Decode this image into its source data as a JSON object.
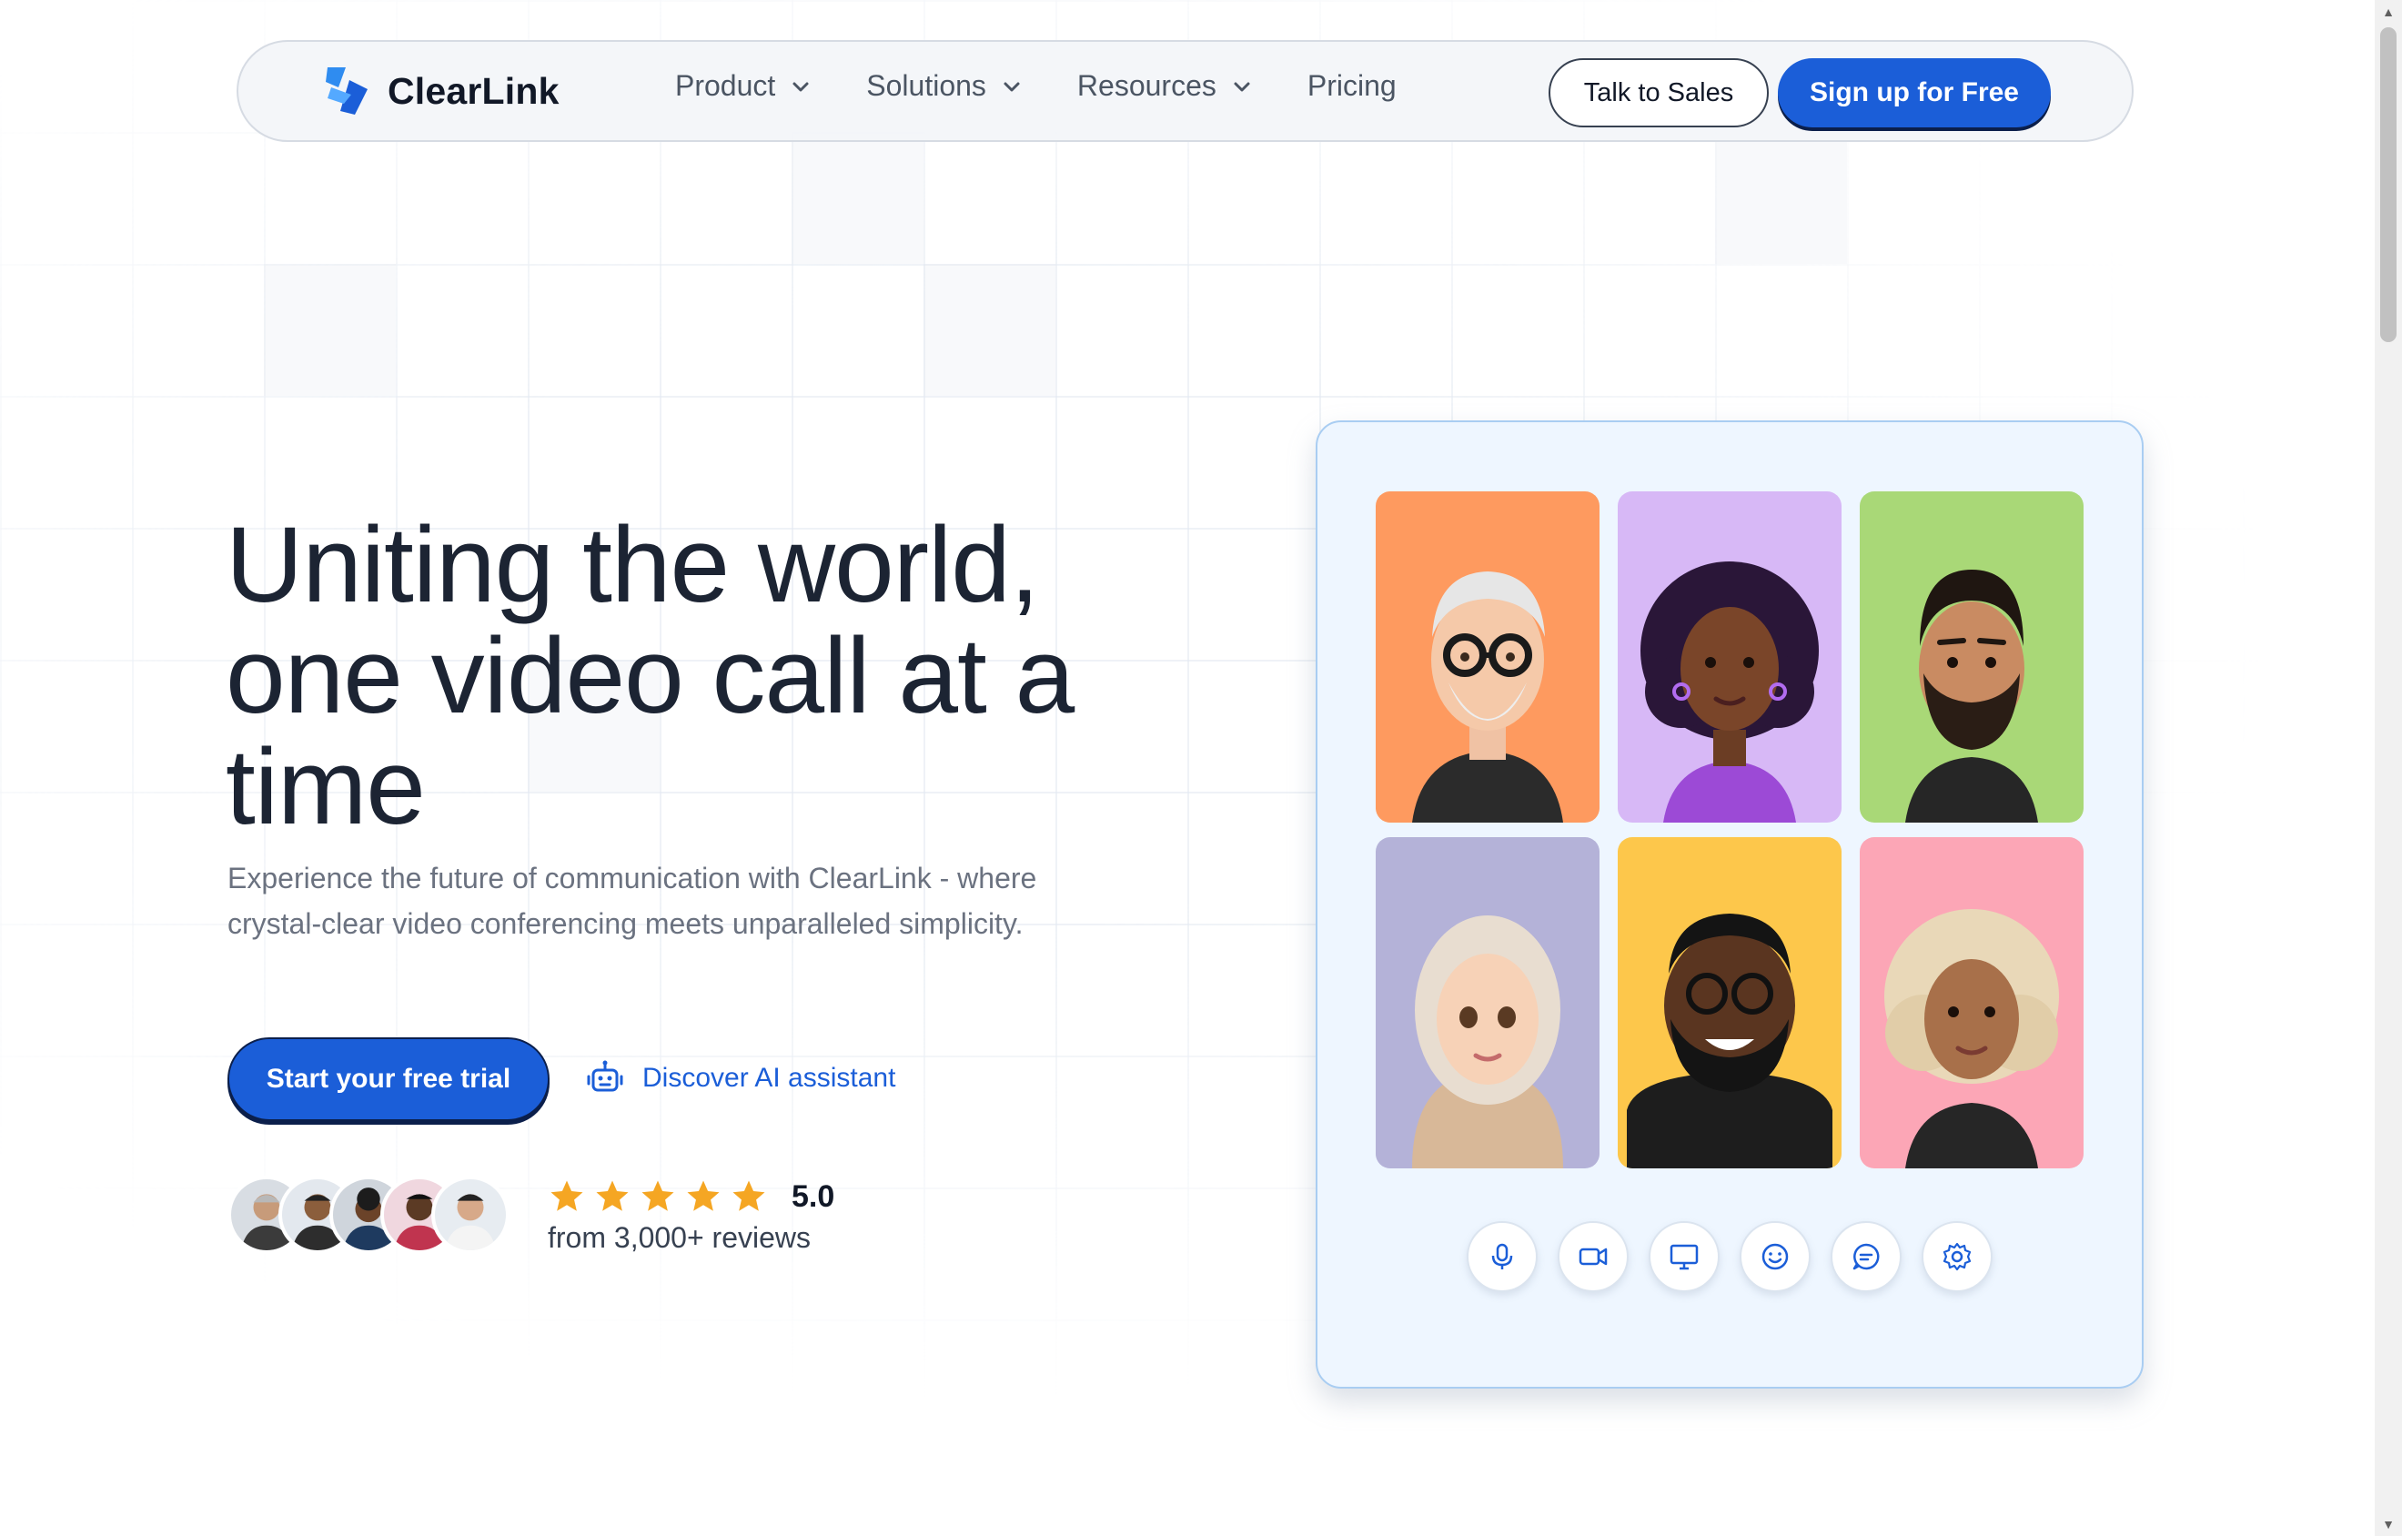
{
  "brand": {
    "name": "ClearLink",
    "logo_icon": "bolt-logo-icon",
    "logo_color": "#2f8cf0"
  },
  "nav": {
    "items": [
      {
        "label": "Product",
        "has_dropdown": true
      },
      {
        "label": "Solutions",
        "has_dropdown": true
      },
      {
        "label": "Resources",
        "has_dropdown": true
      },
      {
        "label": "Pricing",
        "has_dropdown": false
      }
    ],
    "talk_to_sales": "Talk to Sales",
    "signup": "Sign up for Free"
  },
  "hero": {
    "title": "Uniting the world, one video call at a time",
    "subtitle": "Experience the future of communication with ClearLink - where crystal-clear video conferencing meets unparalleled simplicity.",
    "cta_primary": "Start your free trial",
    "cta_secondary": "Discover AI assistant"
  },
  "social_proof": {
    "avatar_count": 5,
    "stars": 5,
    "rating": "5.0",
    "reviews_text": "from 3,000+ reviews"
  },
  "video_panel": {
    "participants": [
      {
        "name": "participant-1",
        "bg": "#fe9a5f"
      },
      {
        "name": "participant-2",
        "bg": "#d7b8f6"
      },
      {
        "name": "participant-3",
        "bg": "#a9d877"
      },
      {
        "name": "participant-4",
        "bg": "#b4b2d8"
      },
      {
        "name": "participant-5",
        "bg": "#fdc74b"
      },
      {
        "name": "participant-6",
        "bg": "#fca6b6"
      }
    ],
    "controls": [
      "microphone-icon",
      "video-camera-icon",
      "screen-share-icon",
      "emoji-icon",
      "chat-icon",
      "settings-icon"
    ]
  },
  "colors": {
    "accent": "#1b5ed8",
    "star": "#f5a623",
    "heading": "#1c2433"
  }
}
